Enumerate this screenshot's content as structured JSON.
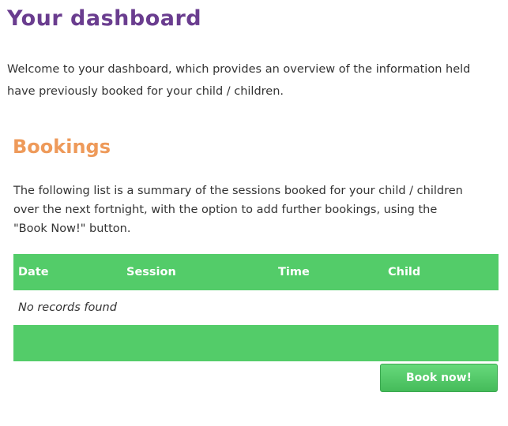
{
  "page": {
    "title": "Your dashboard",
    "intro_lines": [
      "Welcome to your dashboard, which provides an overview of the information held",
      "have previously booked for your child / children."
    ]
  },
  "bookings": {
    "title": "Bookings",
    "summary_lines": [
      "The following list is a summary of the sessions booked for your child / children",
      "over the next fortnight, with the option to add further bookings, using the",
      "\"Book Now!\" button."
    ],
    "table": {
      "columns": [
        "Date",
        "Session",
        "Time",
        "Child"
      ],
      "empty_message": "No records found"
    },
    "book_button_label": "Book now!"
  },
  "colors": {
    "page_title": "#6a3d8f",
    "section_title": "#ee9a5a",
    "table_header": "#53cc69",
    "button": "#4cc261"
  }
}
